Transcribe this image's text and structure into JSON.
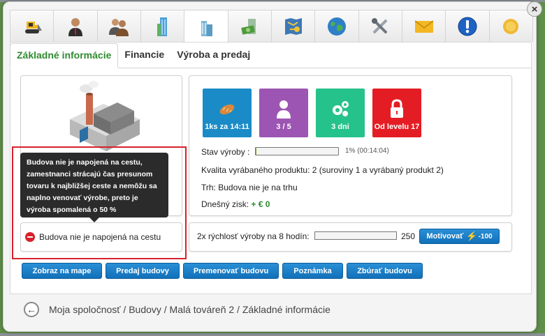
{
  "colors": {
    "tile_time": "#1a8bc7",
    "tile_workers": "#9c55b2",
    "tile_days": "#26c28b",
    "tile_level": "#e41d24",
    "accent_green": "#2f8a2f",
    "button_blue": "#1a7fc9",
    "highlight_red": "#d8212b"
  },
  "top_icons": [
    {
      "name": "bulldozer-icon"
    },
    {
      "name": "manager-icon"
    },
    {
      "name": "employees-icon"
    },
    {
      "name": "skyscraper-icon"
    },
    {
      "name": "factory-building-icon"
    },
    {
      "name": "money-building-icon"
    },
    {
      "name": "map-key-icon"
    },
    {
      "name": "globe-icon"
    },
    {
      "name": "tools-icon"
    },
    {
      "name": "mail-icon"
    },
    {
      "name": "info-icon"
    },
    {
      "name": "coin-icon"
    }
  ],
  "subtabs": {
    "basic_info": "Základné informácie",
    "finance": "Financie",
    "production": "Výroba a predaj"
  },
  "tooltip": {
    "text": "Budova nie je napojená na cestu, zamestnanci strácajú čas presunom tovaru k najbližšej ceste a nemôžu sa naplno venovať výrobe, preto je výroba spomalená o 50 %"
  },
  "status": {
    "label": "Budova nie je napojená na cestu"
  },
  "tiles": {
    "time": {
      "label": "1ks za 14:11",
      "icon": "bread-icon"
    },
    "workers": {
      "label": "3 / 5",
      "icon": "person-icon"
    },
    "days": {
      "label": "3 dni",
      "icon": "gears-icon"
    },
    "level": {
      "label": "Od levelu 17",
      "icon": "lock-icon"
    }
  },
  "info": {
    "production_status_label": "Stav výroby :",
    "production_progress": 0.01,
    "production_progress_text": "1% (00:14:04)",
    "quality": "Kvalita vyrábaného produktu: 2 (suroviny 1 a vyrábaný produkt 2)",
    "market": "Trh: Budova nie je na trhu",
    "profit_label": "Dnešný zisk:",
    "profit_value": "+ € 0"
  },
  "motivation": {
    "text": "2x rýchlosť výroby na 8 hodín:",
    "progress": 0.0,
    "value": "250",
    "button_label": "Motivovať",
    "cost": "-100"
  },
  "actions": {
    "show_map": "Zobraz na mape",
    "sell": "Predaj budovy",
    "rename": "Premenovať budovu",
    "note": "Poznámka",
    "demolish": "Zbúrať budovu"
  },
  "breadcrumb": "Moja spoločnosť / Budovy / Malá továreň 2 / Základné informácie"
}
